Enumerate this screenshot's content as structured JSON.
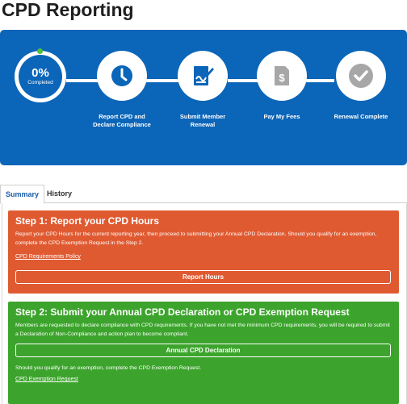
{
  "page": {
    "title": "CPD Reporting"
  },
  "progress": {
    "percent_label": "0%",
    "status": "Completed",
    "fraction": 0
  },
  "steps": [
    {
      "label": "Report CPD and Declare Compliance",
      "icon": "clock-icon"
    },
    {
      "label": "Submit Member Renewal",
      "icon": "document-sign-icon"
    },
    {
      "label": "Pay My Fees",
      "icon": "invoice-dollar-icon"
    },
    {
      "label": "Renewal Complete",
      "icon": "checkmark-icon"
    }
  ],
  "tabs": [
    {
      "label": "Summary",
      "active": true
    },
    {
      "label": "History",
      "active": false
    }
  ],
  "step1": {
    "title": "Step 1: Report your CPD Hours",
    "body": "Report your CPD Hours for the current reporting year, then proceed to submitting your Annual CPD Declaration. Should you qualify for an exemption, complete the CPD Exemption Request in the Step 2.",
    "link": "CPD Requirements Policy",
    "button": "Report Hours",
    "color": "#e05a31"
  },
  "step2": {
    "title": "Step 2: Submit your Annual CPD Declaration or CPD Exemption Request",
    "body": "Members are requested to declare compliance with CPD requirements. If you have not met the minimum CPD requirements, you will be required to submit a Declaration of Non-Compliance and action plan to become compliant.",
    "button": "Annual CPD Declaration",
    "note": "Should you qualify for an exemption, complete the CPD Exemption Request.",
    "link": "CPD Exemption Request",
    "color": "#3ca42c"
  },
  "colors": {
    "hero": "#0b65b8",
    "accent_dot": "#52c13c",
    "icon_gray": "#a7a7a7"
  }
}
